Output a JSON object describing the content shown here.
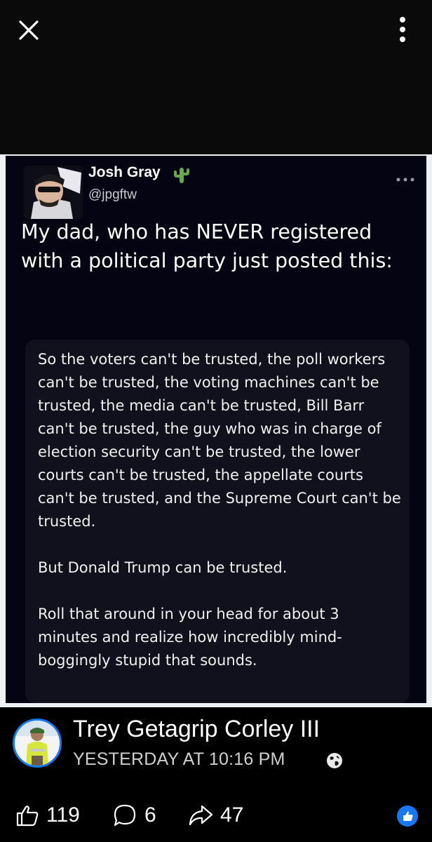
{
  "viewer": {
    "close_icon": "close-icon",
    "more_icon": "more-vertical-icon"
  },
  "tweet": {
    "name": "Josh Gray",
    "name_emoji_icon": "cactus-icon",
    "handle": "@jpgftw",
    "more_icon": "more-horizontal-icon",
    "text": "My dad, who has NEVER registered with a political party just posted this:",
    "quote": "So the voters can't be trusted, the poll workers can't be trusted, the voting machines can't be trusted, the media can't be trusted, Bill Barr can't be trusted, the guy who was in charge of election security can't be trusted, the lower courts can't be trusted, the appellate courts can't be trusted, and the Supreme Court can't be trusted.\n\nBut Donald Trump can be trusted.\n\nRoll that around in your head for about 3 minutes and realize how incredibly mind-boggingly stupid that sounds."
  },
  "post": {
    "author": "Trey Getagrip Corley III",
    "timestamp": "YESTERDAY AT 10:16 PM",
    "privacy_icon": "globe-icon"
  },
  "actions": {
    "likes": "119",
    "comments": "6",
    "shares": "47"
  },
  "colors": {
    "accent": "#1877f2",
    "background": "#000000"
  }
}
